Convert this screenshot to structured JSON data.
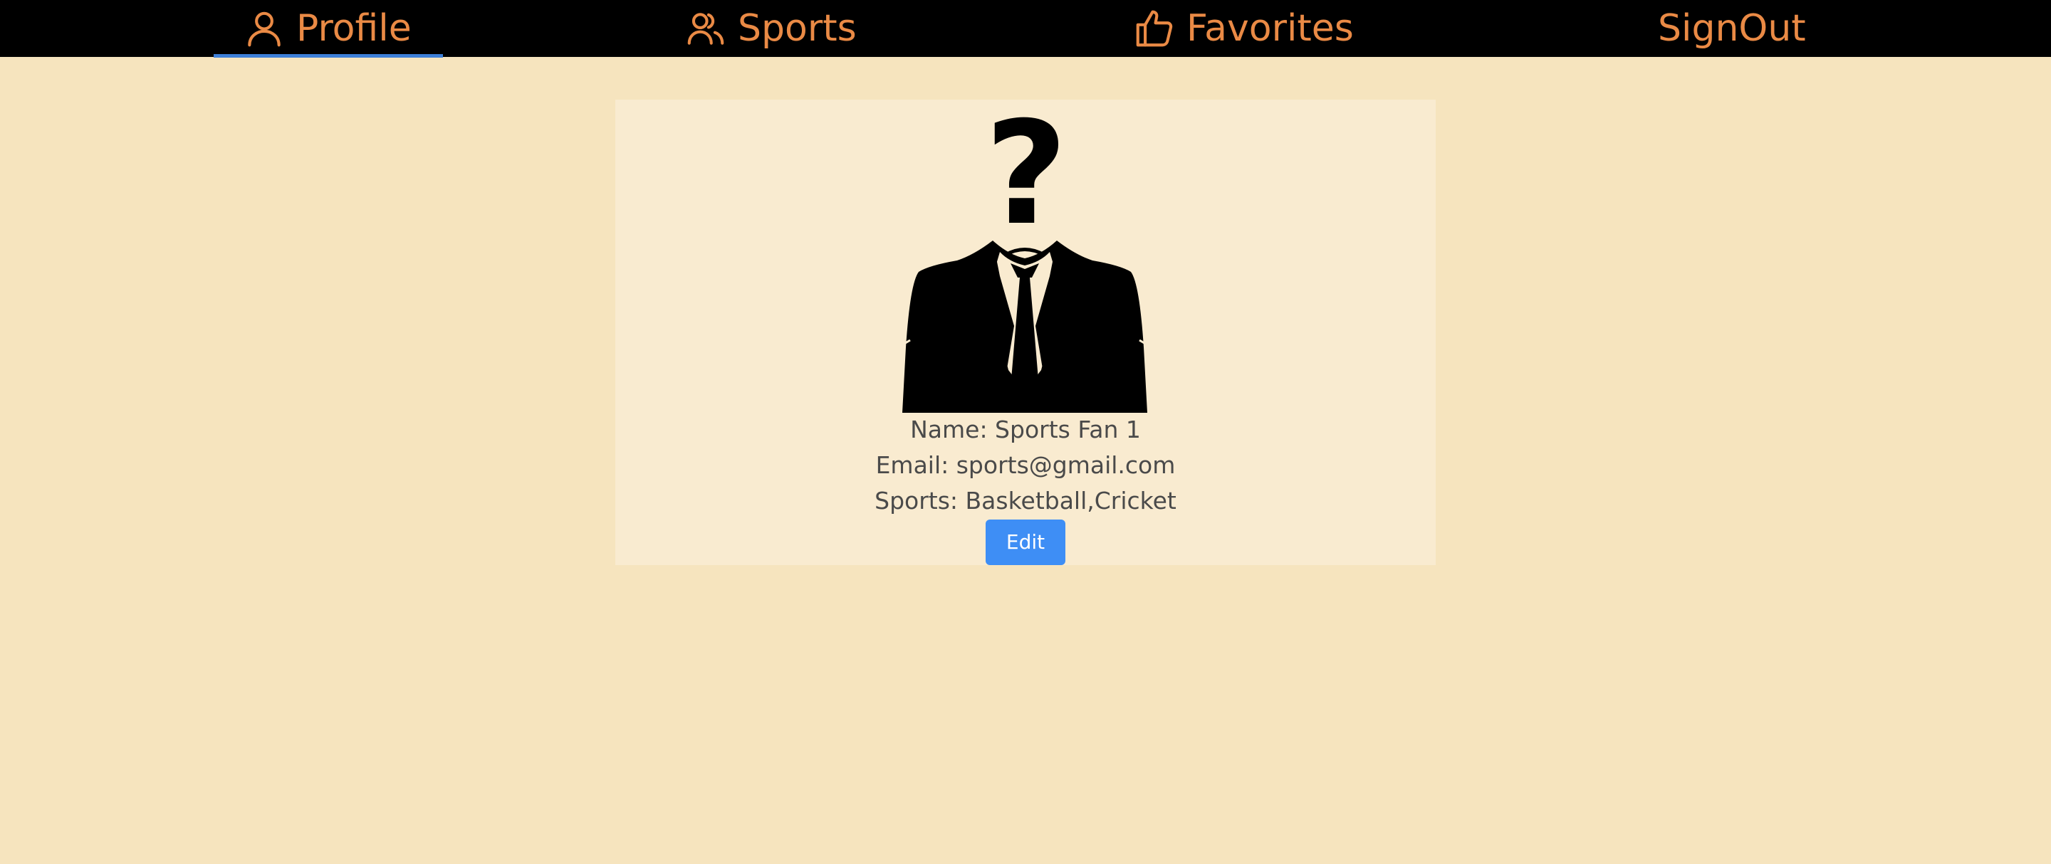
{
  "nav": {
    "tabs": [
      {
        "label": "Profile",
        "icon": "user-icon",
        "active": true
      },
      {
        "label": "Sports",
        "icon": "users-icon",
        "active": false
      },
      {
        "label": "Favorites",
        "icon": "thumbs-up-icon",
        "active": false
      },
      {
        "label": "SignOut",
        "icon": "",
        "active": false
      }
    ],
    "text_color": "#ea8a45",
    "background": "#000000",
    "active_indicator_color": "#3d7fd8"
  },
  "profile": {
    "avatar_icon": "anonymous-suit-icon",
    "name_line": "Name: Sports Fan 1",
    "email_line": "Email: sports@gmail.com",
    "sports_line": "Sports: Basketball,Cricket",
    "edit_label": "Edit"
  },
  "colors": {
    "page_background": "#f6e4be",
    "card_background": "#f9ebd0",
    "button": "#3e8ef5"
  }
}
